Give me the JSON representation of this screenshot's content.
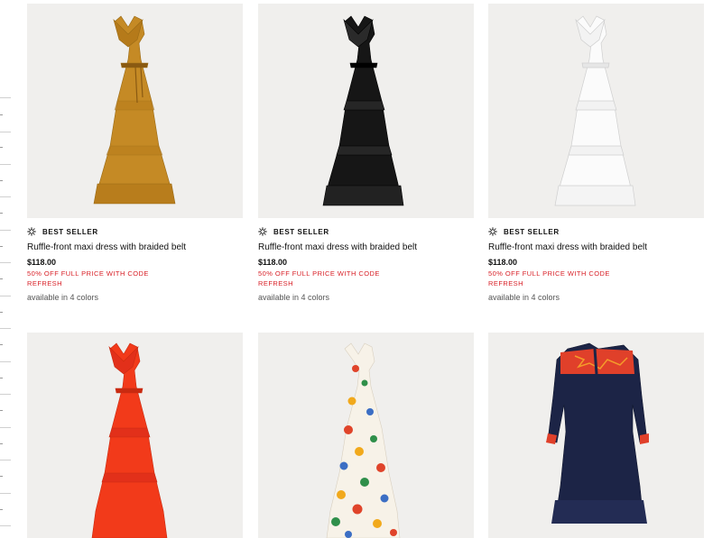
{
  "products": [
    {
      "badge": "BEST SELLER",
      "name": "Ruffle-front maxi dress with braided belt",
      "price": "$118.00",
      "promo": "50% OFF FULL PRICE WITH CODE REFRESH",
      "colors": "available in 4 colors",
      "image": "mustard-maxi-dress",
      "dress_color": "#c58a25"
    },
    {
      "badge": "BEST SELLER",
      "name": "Ruffle-front maxi dress with braided belt",
      "price": "$118.00",
      "promo": "50% OFF FULL PRICE WITH CODE REFRESH",
      "colors": "available in 4 colors",
      "image": "black-maxi-dress",
      "dress_color": "#161616"
    },
    {
      "badge": "BEST SELLER",
      "name": "Ruffle-front maxi dress with braided belt",
      "price": "$118.00",
      "promo": "50% OFF FULL PRICE WITH CODE REFRESH",
      "colors": "available in 4 colors",
      "image": "white-maxi-dress",
      "dress_color": "#fbfbfb"
    },
    {
      "image": "red-maxi-dress",
      "dress_color": "#f23a1a"
    },
    {
      "image": "floral-maxi-dress",
      "dress_color": "#f7f2e8"
    },
    {
      "image": "navy-embroidered-dress",
      "dress_color": "#1c2446"
    }
  ],
  "colors": {
    "promo_red": "#d81f26",
    "image_bg": "#f0efed",
    "embroidery_red": "#e0402a"
  }
}
